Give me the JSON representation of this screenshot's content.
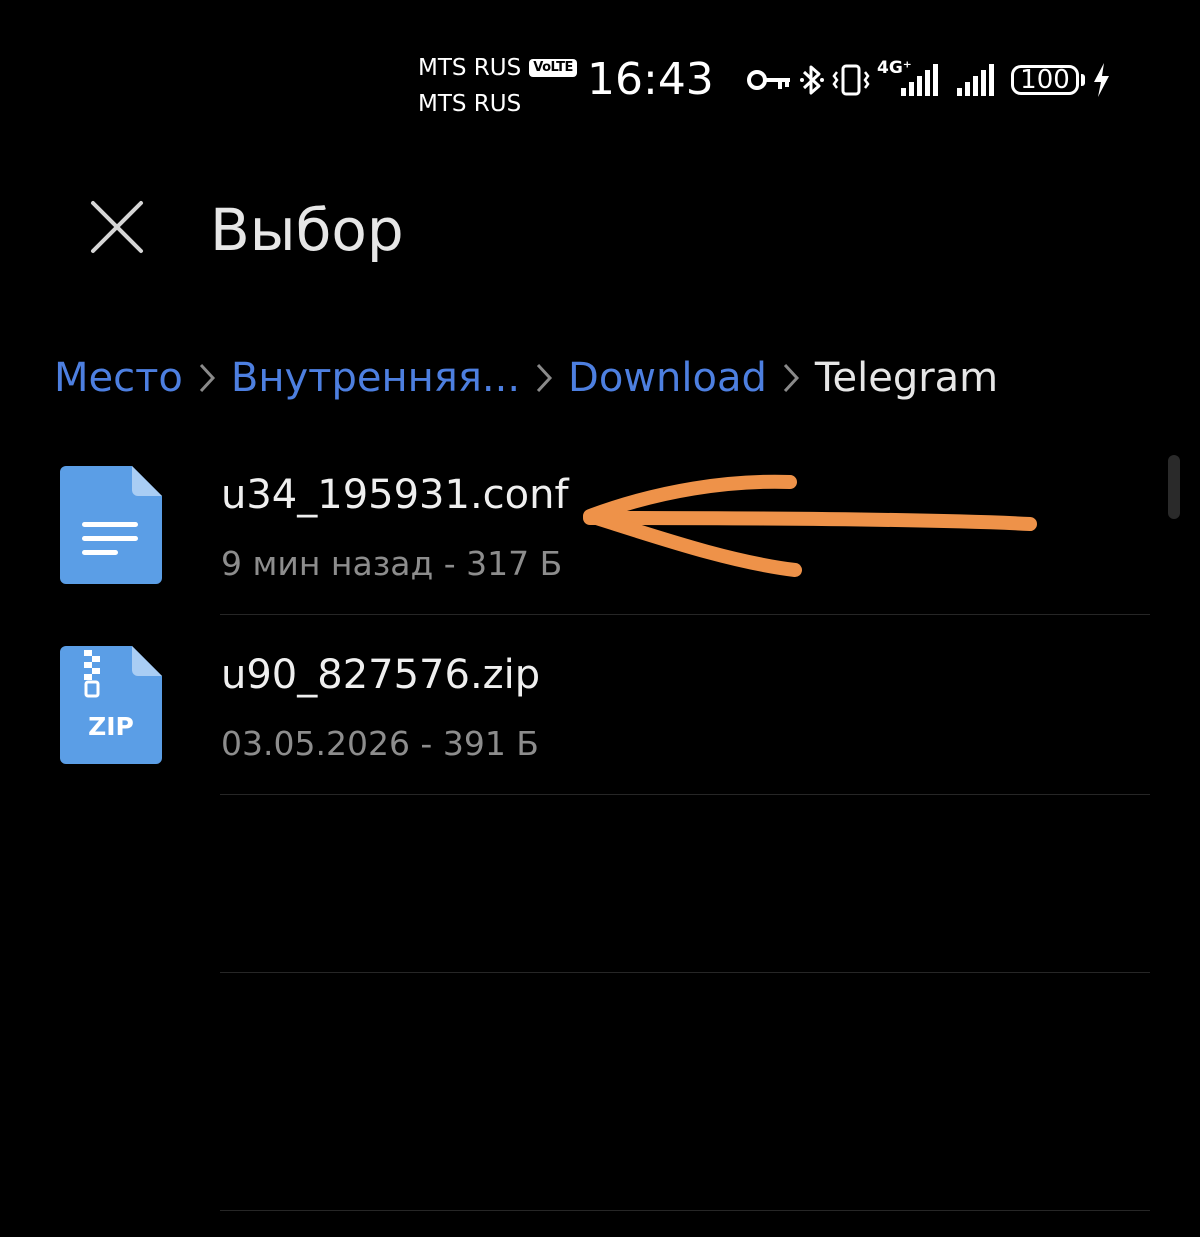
{
  "status_bar": {
    "carrier_1": "MTS RUS",
    "carrier_1_badge": "VoLTE",
    "carrier_2": "MTS RUS",
    "time": "16:43",
    "network_type": "4G⁺",
    "battery_level": "100",
    "icons": [
      "key-icon",
      "bluetooth-icon",
      "vibrate-icon",
      "signal-icon",
      "signal-icon",
      "battery-icon",
      "charging-icon"
    ]
  },
  "header": {
    "close_icon": "close-icon",
    "title": "Выбор"
  },
  "breadcrumb": [
    {
      "label": "Место"
    },
    {
      "label": "Внутренняя..."
    },
    {
      "label": "Download"
    },
    {
      "label": "Telegram"
    }
  ],
  "files": [
    {
      "name": "u34_195931.conf",
      "meta": "9 мин назад - 317 Б",
      "icon": "document-icon"
    },
    {
      "name": "u90_827576.zip",
      "meta": "03.05.2026 - 391 Б",
      "icon": "zip-icon",
      "icon_label": "ZIP"
    }
  ],
  "colors": {
    "background": "#000000",
    "breadcrumb_link": "#4d7fe0",
    "file_icon": "#5b9ee6",
    "annotation_arrow": "#ee9249"
  }
}
